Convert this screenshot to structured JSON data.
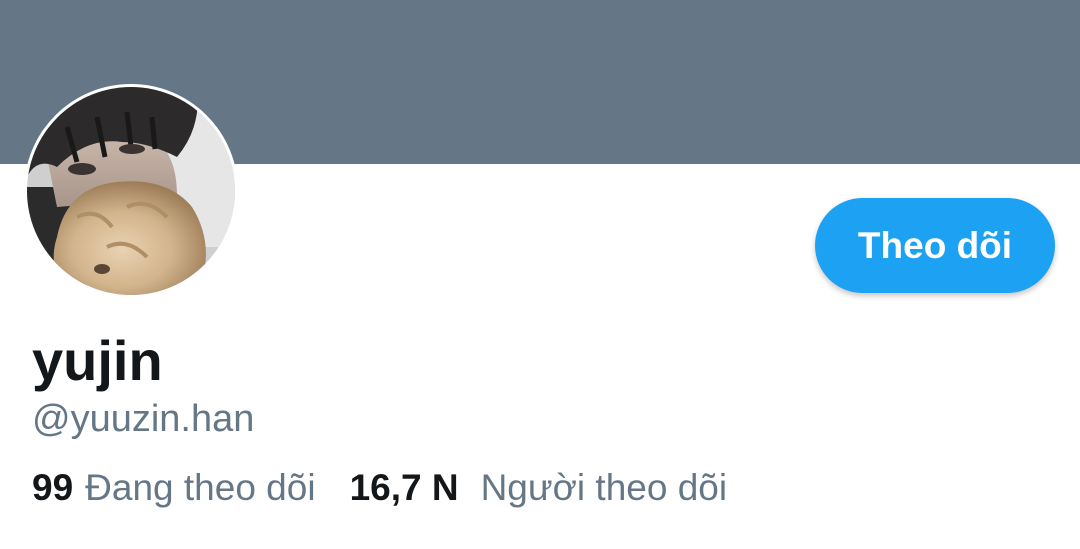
{
  "profile": {
    "display_name": "yujin",
    "handle": "@yuuzin.han",
    "follow_button_label": "Theo dõi",
    "following_count": "99",
    "following_label": "Đang theo dõi",
    "followers_count": "16,7 N",
    "followers_label": "Người theo dõi"
  },
  "colors": {
    "banner": "#657786",
    "accent": "#1da1f2",
    "primary_text": "#14171a",
    "secondary_text": "#657786"
  },
  "icons": {
    "avatar": "profile-photo"
  }
}
